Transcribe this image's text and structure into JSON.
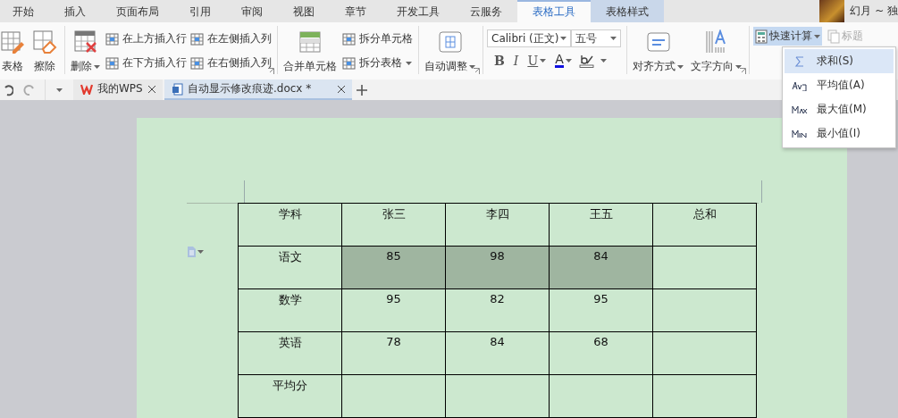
{
  "menu_tabs": [
    {
      "label": "开始",
      "selected": false
    },
    {
      "label": "插入",
      "selected": false
    },
    {
      "label": "页面布局",
      "selected": false
    },
    {
      "label": "引用",
      "selected": false
    },
    {
      "label": "审阅",
      "selected": false
    },
    {
      "label": "视图",
      "selected": false
    },
    {
      "label": "章节",
      "selected": false
    },
    {
      "label": "开发工具",
      "selected": false
    },
    {
      "label": "云服务",
      "selected": false
    },
    {
      "label": "表格工具",
      "selected": true
    },
    {
      "label": "表格样式",
      "selected": false
    }
  ],
  "user": {
    "name": "幻月 ~ 独"
  },
  "ribbon": {
    "groups": [
      {
        "items": [
          {
            "kind": "large",
            "label": "表格",
            "dropdown": false
          },
          {
            "kind": "large",
            "label": "擦除",
            "dropdown": false
          }
        ],
        "launcher": false
      },
      {
        "items": [
          {
            "kind": "large",
            "label": "删除",
            "dropdown": true
          },
          {
            "kind": "stack",
            "rows": [
              {
                "label": "在上方插入行",
                "dropdown": false
              },
              {
                "label": "在下方插入行",
                "dropdown": false
              }
            ]
          },
          {
            "kind": "stack",
            "rows": [
              {
                "label": "在左侧插入列",
                "dropdown": false
              },
              {
                "label": "在右侧插入列",
                "dropdown": false
              }
            ]
          }
        ],
        "launcher": true
      },
      {
        "items": [
          {
            "kind": "large",
            "label": "合并单元格",
            "dropdown": false
          },
          {
            "kind": "stack",
            "rows": [
              {
                "label": "拆分单元格",
                "dropdown": false
              },
              {
                "label": "拆分表格",
                "dropdown": true
              }
            ]
          }
        ],
        "launcher": false
      },
      {
        "items": [
          {
            "kind": "large",
            "label": "自动调整",
            "dropdown": true
          }
        ],
        "launcher": true
      },
      {
        "items": [
          {
            "kind": "font",
            "font": "Calibri (正文)",
            "size": "五号",
            "bold": "B",
            "italic": "I",
            "underline": "U",
            "color_letter": "A"
          }
        ],
        "launcher": false
      },
      {
        "items": [
          {
            "kind": "large",
            "label": "对齐方式",
            "dropdown": true
          },
          {
            "kind": "large",
            "label": "文字方向",
            "dropdown": true
          }
        ],
        "launcher": true
      },
      {
        "items": [
          {
            "kind": "quick",
            "label": "快速计算",
            "expanded": true
          },
          {
            "kind": "quick",
            "label": "标题",
            "disabled": true
          }
        ],
        "launcher": false
      }
    ]
  },
  "quick_menu": {
    "items": [
      {
        "label": "求和(S)",
        "selected": true
      },
      {
        "label": "平均值(A)",
        "selected": false
      },
      {
        "label": "最大值(M)",
        "selected": false
      },
      {
        "label": "最小值(I)",
        "selected": false
      }
    ]
  },
  "doc_tabs": [
    {
      "label": "我的WPS",
      "selected": false
    },
    {
      "label": "自动显示修改痕迹.docx *",
      "selected": true
    }
  ],
  "table": {
    "rows": [
      {
        "cells": [
          {
            "text": "学科",
            "selected": false
          },
          {
            "text": "张三",
            "selected": false
          },
          {
            "text": "李四",
            "selected": false
          },
          {
            "text": "王五",
            "selected": false
          },
          {
            "text": "总和",
            "selected": false
          }
        ]
      },
      {
        "cells": [
          {
            "text": "语文",
            "selected": false
          },
          {
            "text": "85",
            "selected": true
          },
          {
            "text": "98",
            "selected": true
          },
          {
            "text": "84",
            "selected": true
          },
          {
            "text": "",
            "selected": false
          }
        ]
      },
      {
        "cells": [
          {
            "text": "数学",
            "selected": false
          },
          {
            "text": "95",
            "selected": false
          },
          {
            "text": "82",
            "selected": false
          },
          {
            "text": "95",
            "selected": false
          },
          {
            "text": "",
            "selected": false
          }
        ]
      },
      {
        "cells": [
          {
            "text": "英语",
            "selected": false
          },
          {
            "text": "78",
            "selected": false
          },
          {
            "text": "84",
            "selected": false
          },
          {
            "text": "68",
            "selected": false
          },
          {
            "text": "",
            "selected": false
          }
        ]
      },
      {
        "cells": [
          {
            "text": "平均分",
            "selected": false
          },
          {
            "text": "",
            "selected": false
          },
          {
            "text": "",
            "selected": false
          },
          {
            "text": "",
            "selected": false
          },
          {
            "text": "",
            "selected": false
          }
        ]
      }
    ]
  }
}
